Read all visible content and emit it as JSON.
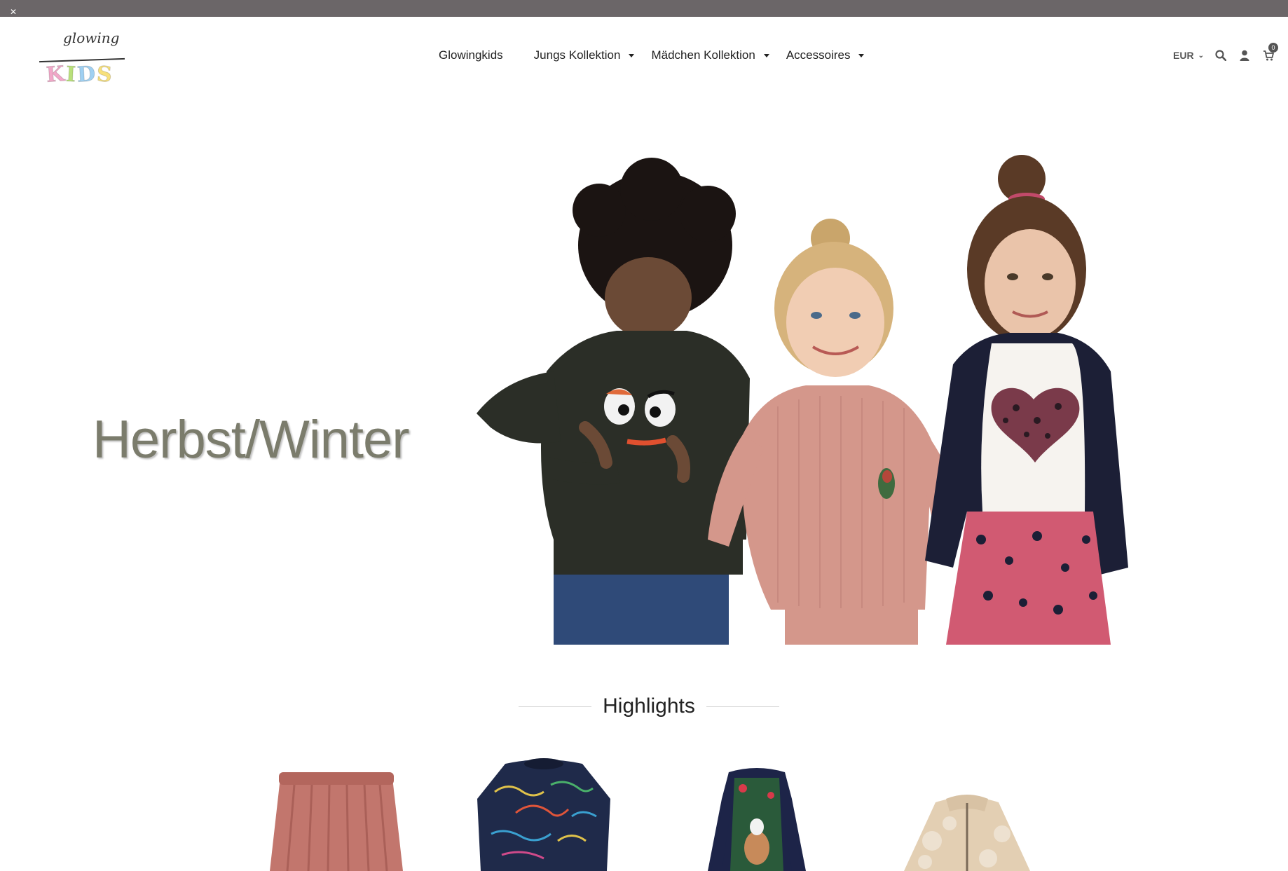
{
  "topbar": {
    "close_icon": "close-icon"
  },
  "logo": {
    "script": "glowing",
    "letters": [
      "K",
      "I",
      "D",
      "S"
    ]
  },
  "nav": {
    "items": [
      {
        "label": "Glowingkids",
        "has_dropdown": false
      },
      {
        "label": "Jungs Kollektion",
        "has_dropdown": true
      },
      {
        "label": "Mädchen Kollektion",
        "has_dropdown": true
      },
      {
        "label": "Accessoires",
        "has_dropdown": true
      }
    ]
  },
  "tools": {
    "currency": "EUR",
    "icons": [
      "search-icon",
      "user-icon",
      "cart-icon"
    ],
    "cart_count": "0"
  },
  "hero": {
    "title": "Herbst/Winter"
  },
  "highlights": {
    "heading": "Highlights"
  },
  "colors": {
    "topbar": "#6b6668",
    "hero_title": "#7b7c6c",
    "text": "#222222"
  }
}
